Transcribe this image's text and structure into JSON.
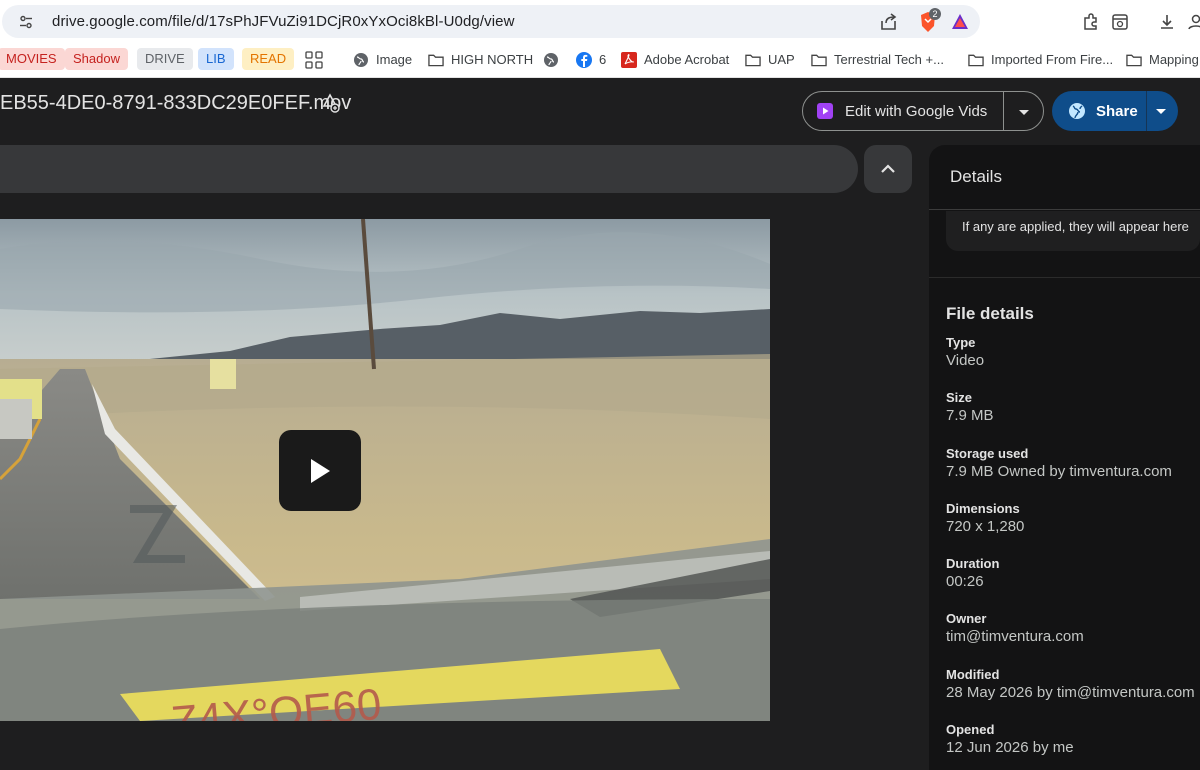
{
  "browser": {
    "url": "drive.google.com/file/d/17sPhJFVuZi91DCjR0xYxOci8kBl-U0dg/view",
    "brave_badge": "2"
  },
  "bookmarks": [
    {
      "label": "MOVIES",
      "type": "chip",
      "bg": "#fbd7d4",
      "fg": "#c5221f"
    },
    {
      "label": "Shadow",
      "type": "chip",
      "bg": "#fbd7d4",
      "fg": "#c5221f"
    },
    {
      "label": "DRIVE",
      "type": "chip",
      "bg": "#e8eaed",
      "fg": "#5f6368"
    },
    {
      "label": "LIB",
      "type": "chip",
      "bg": "#d2e3fc",
      "fg": "#1967d2"
    },
    {
      "label": "READ",
      "type": "chip",
      "bg": "#feefc3",
      "fg": "#e37400"
    },
    {
      "label": "Image",
      "icon": "globe-icon"
    },
    {
      "label": "HIGH NORTH",
      "icon": "folder-icon"
    },
    {
      "label": "6",
      "icon": "facebook-icon"
    },
    {
      "label": "Adobe Acrobat",
      "icon": "acrobat-icon"
    },
    {
      "label": "UAP",
      "icon": "folder-icon"
    },
    {
      "label": "Terrestrial Tech +...",
      "icon": "folder-icon"
    },
    {
      "label": "Imported From Fire...",
      "icon": "folder-icon"
    },
    {
      "label": "Mapping",
      "icon": "folder-icon"
    }
  ],
  "header": {
    "file_title": "EB55-4DE0-8791-833DC29E0FEF.mov",
    "vids_label": "Edit with Google Vids",
    "share_label": "Share"
  },
  "details": {
    "title": "Details",
    "note": "If any are applied, they will appear here",
    "file_details_title": "File details",
    "rows": [
      {
        "label": "Type",
        "value": "Video"
      },
      {
        "label": "Size",
        "value": "7.9 MB"
      },
      {
        "label": "Storage used",
        "value": "7.9 MB Owned by timventura.com"
      },
      {
        "label": "Dimensions",
        "value": "720 x 1,280"
      },
      {
        "label": "Duration",
        "value": "00:26"
      },
      {
        "label": "Owner",
        "value": "tim@timventura.com"
      },
      {
        "label": "Modified",
        "value": "28 May 2026 by tim@timventura.com"
      },
      {
        "label": "Opened",
        "value": "12 Jun 2026 by me"
      }
    ]
  },
  "colors": {
    "accent_share": "#0f4d8a",
    "vids_icon": "#a142f4",
    "brave": "#fb542b",
    "facebook": "#1877f2",
    "acrobat": "#d7271d"
  }
}
